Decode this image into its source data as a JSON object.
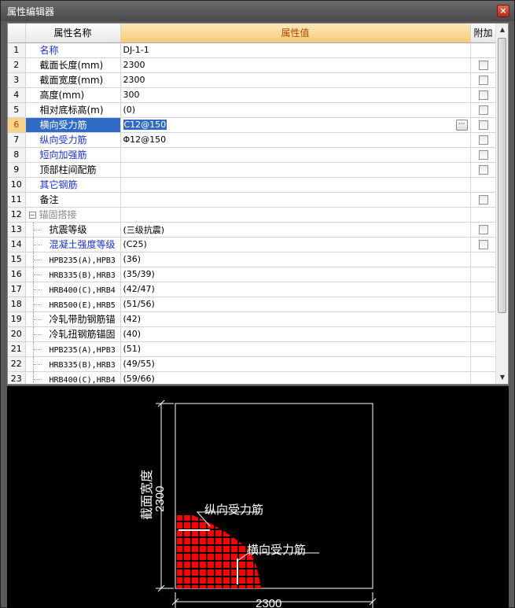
{
  "window": {
    "title": "属性编辑器",
    "close_glyph": "×"
  },
  "columns": {
    "name": "属性名称",
    "value": "属性值",
    "extra": "附加"
  },
  "rows": [
    {
      "num": "1",
      "name": "名称",
      "value": "DJ-1-1",
      "style": "blue",
      "checkbox": false
    },
    {
      "num": "2",
      "name": "截面长度(mm)",
      "value": "2300",
      "style": "",
      "checkbox": true
    },
    {
      "num": "3",
      "name": "截面宽度(mm)",
      "value": "2300",
      "style": "",
      "checkbox": true
    },
    {
      "num": "4",
      "name": "高度(mm)",
      "value": "300",
      "style": "",
      "checkbox": true
    },
    {
      "num": "5",
      "name": "相对底标高(m)",
      "value": "(0)",
      "style": "",
      "checkbox": true
    },
    {
      "num": "6",
      "name": "横向受力筋",
      "value": "C12@150",
      "style": "sel",
      "checkbox": true,
      "selected": true
    },
    {
      "num": "7",
      "name": "纵向受力筋",
      "value": "Φ12@150",
      "style": "blue",
      "checkbox": true
    },
    {
      "num": "8",
      "name": "短向加强筋",
      "value": "",
      "style": "blue",
      "checkbox": true
    },
    {
      "num": "9",
      "name": "顶部柱间配筋",
      "value": "",
      "style": "",
      "checkbox": true
    },
    {
      "num": "10",
      "name": "其它钢筋",
      "value": "",
      "style": "blue",
      "checkbox": false
    },
    {
      "num": "11",
      "name": "备注",
      "value": "",
      "style": "",
      "checkbox": true
    },
    {
      "num": "12",
      "name": "锚固搭接",
      "value": "",
      "style": "group",
      "checkbox": false
    },
    {
      "num": "13",
      "name": "抗震等级",
      "value": "(三级抗震)",
      "style": "sub",
      "checkbox": true
    },
    {
      "num": "14",
      "name": "混凝土强度等级",
      "value": "(C25)",
      "style": "sub blue",
      "checkbox": true
    },
    {
      "num": "15",
      "name": "HPB235(A),HPB3",
      "value": "(36)",
      "style": "sub mono",
      "checkbox": false
    },
    {
      "num": "16",
      "name": "HRB335(B),HRB3",
      "value": "(35/39)",
      "style": "sub mono",
      "checkbox": false
    },
    {
      "num": "17",
      "name": "HRB400(C),HRB4",
      "value": "(42/47)",
      "style": "sub mono",
      "checkbox": false
    },
    {
      "num": "18",
      "name": "HRB500(E),HRB5",
      "value": "(51/56)",
      "style": "sub mono",
      "checkbox": false
    },
    {
      "num": "19",
      "name": "冷轧带肋钢筋锚",
      "value": "(42)",
      "style": "sub",
      "checkbox": false
    },
    {
      "num": "20",
      "name": "冷轧扭钢筋锚固",
      "value": "(40)",
      "style": "sub",
      "checkbox": false
    },
    {
      "num": "21",
      "name": "HPB235(A),HPB3",
      "value": "(51)",
      "style": "sub mono",
      "checkbox": false
    },
    {
      "num": "22",
      "name": "HRB335(B),HRB3",
      "value": "(49/55)",
      "style": "sub mono",
      "checkbox": false
    },
    {
      "num": "23",
      "name": "HRB400(C),HRB4",
      "value": "(59/66)",
      "style": "sub mono",
      "checkbox": false
    }
  ],
  "preview": {
    "width_dim": "2300",
    "length_dim": "2300",
    "width_label": "截面宽度",
    "long_rebar_label": "纵向受力筋",
    "trans_rebar_label": "横向受力筋"
  },
  "colors": {
    "selection": "#316ac5",
    "link_blue": "#1a2fd8",
    "header_orange": "#f5c97a",
    "rebar_red": "#ff0000"
  }
}
